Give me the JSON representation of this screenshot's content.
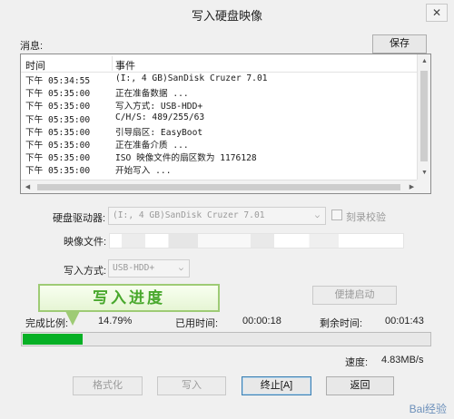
{
  "window": {
    "title": "写入硬盘映像",
    "close_symbol": "✕"
  },
  "messages": {
    "label": "消息:",
    "save_button": "保存",
    "columns": {
      "time": "时间",
      "event": "事件"
    },
    "rows": [
      {
        "time": "下午 05:34:55",
        "event": "(I:, 4 GB)SanDisk Cruzer           7.01"
      },
      {
        "time": "下午 05:35:00",
        "event": "正在准备数据 ..."
      },
      {
        "time": "下午 05:35:00",
        "event": "写入方式: USB-HDD+"
      },
      {
        "time": "下午 05:35:00",
        "event": "C/H/S: 489/255/63"
      },
      {
        "time": "下午 05:35:00",
        "event": "引导扇区: EasyBoot"
      },
      {
        "time": "下午 05:35:00",
        "event": "正在准备介质 ..."
      },
      {
        "time": "下午 05:35:00",
        "event": "ISO 映像文件的扇区数为 1176128"
      },
      {
        "time": "下午 05:35:00",
        "event": "开始写入 ..."
      }
    ]
  },
  "drive": {
    "label": "硬盘驱动器:",
    "value": "(I:, 4 GB)SanDisk Cruzer         7.01",
    "verify_label": "刻录校验"
  },
  "image_file": {
    "label": "映像文件:"
  },
  "write_mode": {
    "label": "写入方式:",
    "value": "USB-HDD+"
  },
  "portable_boot_button": "便捷启动",
  "tooltip": {
    "text": "写入进度"
  },
  "status": {
    "completion_label": "完成比例:",
    "completion_value": "14.79%",
    "elapsed_label": "已用时间:",
    "elapsed_value": "00:00:18",
    "remaining_label": "剩余时间:",
    "remaining_value": "00:01:43",
    "speed_label": "速度:",
    "speed_value": "4.83MB/s"
  },
  "progress": {
    "fraction": 0.1479,
    "color": "#06b025"
  },
  "buttons": {
    "format": "格式化",
    "write": "写入",
    "stop": "终止[A]",
    "back": "返回"
  },
  "watermark": "Bai经验"
}
